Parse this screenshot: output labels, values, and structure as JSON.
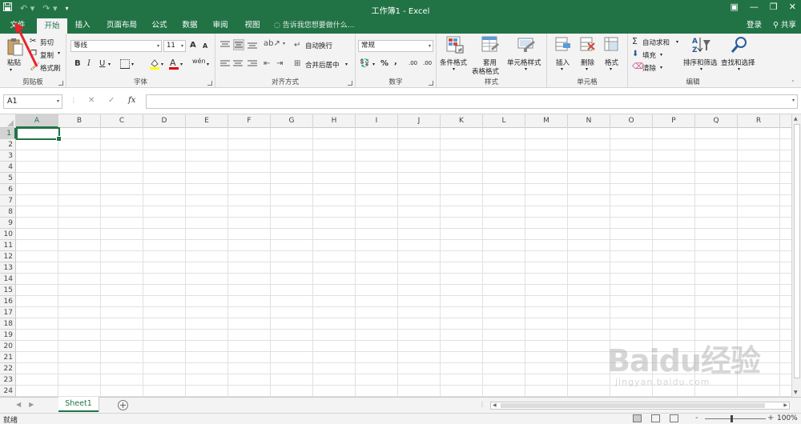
{
  "title_bar": {
    "title": "工作簿1 - Excel",
    "icons": [
      "save-icon",
      "undo-icon",
      "redo-icon",
      "customize-qat-icon",
      "ribbon-display-icon",
      "minimize-icon",
      "restore-icon",
      "close-icon"
    ]
  },
  "tabs": {
    "items": [
      "文件",
      "开始",
      "插入",
      "页面布局",
      "公式",
      "数据",
      "审阅",
      "视图"
    ],
    "active": "开始",
    "tell_me": "告诉我您想要做什么...",
    "sign_in": "登录",
    "share": "共享"
  },
  "ribbon": {
    "clipboard": {
      "paste": "粘贴",
      "cut": "剪切",
      "copy": "复制",
      "format_painter": "格式刷",
      "label": "剪贴板"
    },
    "font": {
      "font_name": "等线",
      "font_size": "11",
      "label": "字体",
      "bold": "B",
      "italic": "I",
      "underline": "U",
      "grow": "A",
      "shrink": "A"
    },
    "alignment": {
      "wrap_text": "自动换行",
      "merge_center": "合并后居中",
      "label": "对齐方式"
    },
    "number": {
      "format": "常规",
      "percent": "%",
      "comma": ",",
      "inc_decimal": ".00",
      "dec_decimal": ".00",
      "label": "数字"
    },
    "styles": {
      "conditional": "条件格式",
      "table_1": "套用",
      "table_2": "表格格式",
      "cell_styles": "单元格样式",
      "label": "样式"
    },
    "cells": {
      "insert": "插入",
      "delete": "删除",
      "format": "格式",
      "label": "单元格"
    },
    "editing": {
      "autosum": "自动求和",
      "fill": "填充",
      "clear": "清除",
      "sort_filter": "排序和筛选",
      "find_select": "查找和选择",
      "label": "编辑"
    }
  },
  "formula_bar": {
    "name_box": "A1",
    "fx": "fx",
    "formula": ""
  },
  "grid": {
    "columns": [
      "A",
      "B",
      "C",
      "D",
      "E",
      "F",
      "G",
      "H",
      "I",
      "J",
      "K",
      "L",
      "M",
      "N",
      "O",
      "P",
      "Q",
      "R"
    ],
    "rows": [
      "1",
      "2",
      "3",
      "4",
      "5",
      "6",
      "7",
      "8",
      "9",
      "10",
      "11",
      "12",
      "13",
      "14",
      "15",
      "16",
      "17",
      "18",
      "19",
      "20",
      "21",
      "22",
      "23",
      "24"
    ],
    "active_cell": "A1"
  },
  "sheets": {
    "items": [
      "Sheet1"
    ],
    "active": "Sheet1",
    "add": "+"
  },
  "status_bar": {
    "ready": "就绪",
    "zoom": "100%",
    "zoom_out": "-",
    "zoom_in": "+"
  },
  "colors": {
    "accent": "#217346",
    "annotation": "#e8242a"
  },
  "watermark": {
    "brand": "Baidu经验",
    "url": "jingyan.baidu.com"
  }
}
